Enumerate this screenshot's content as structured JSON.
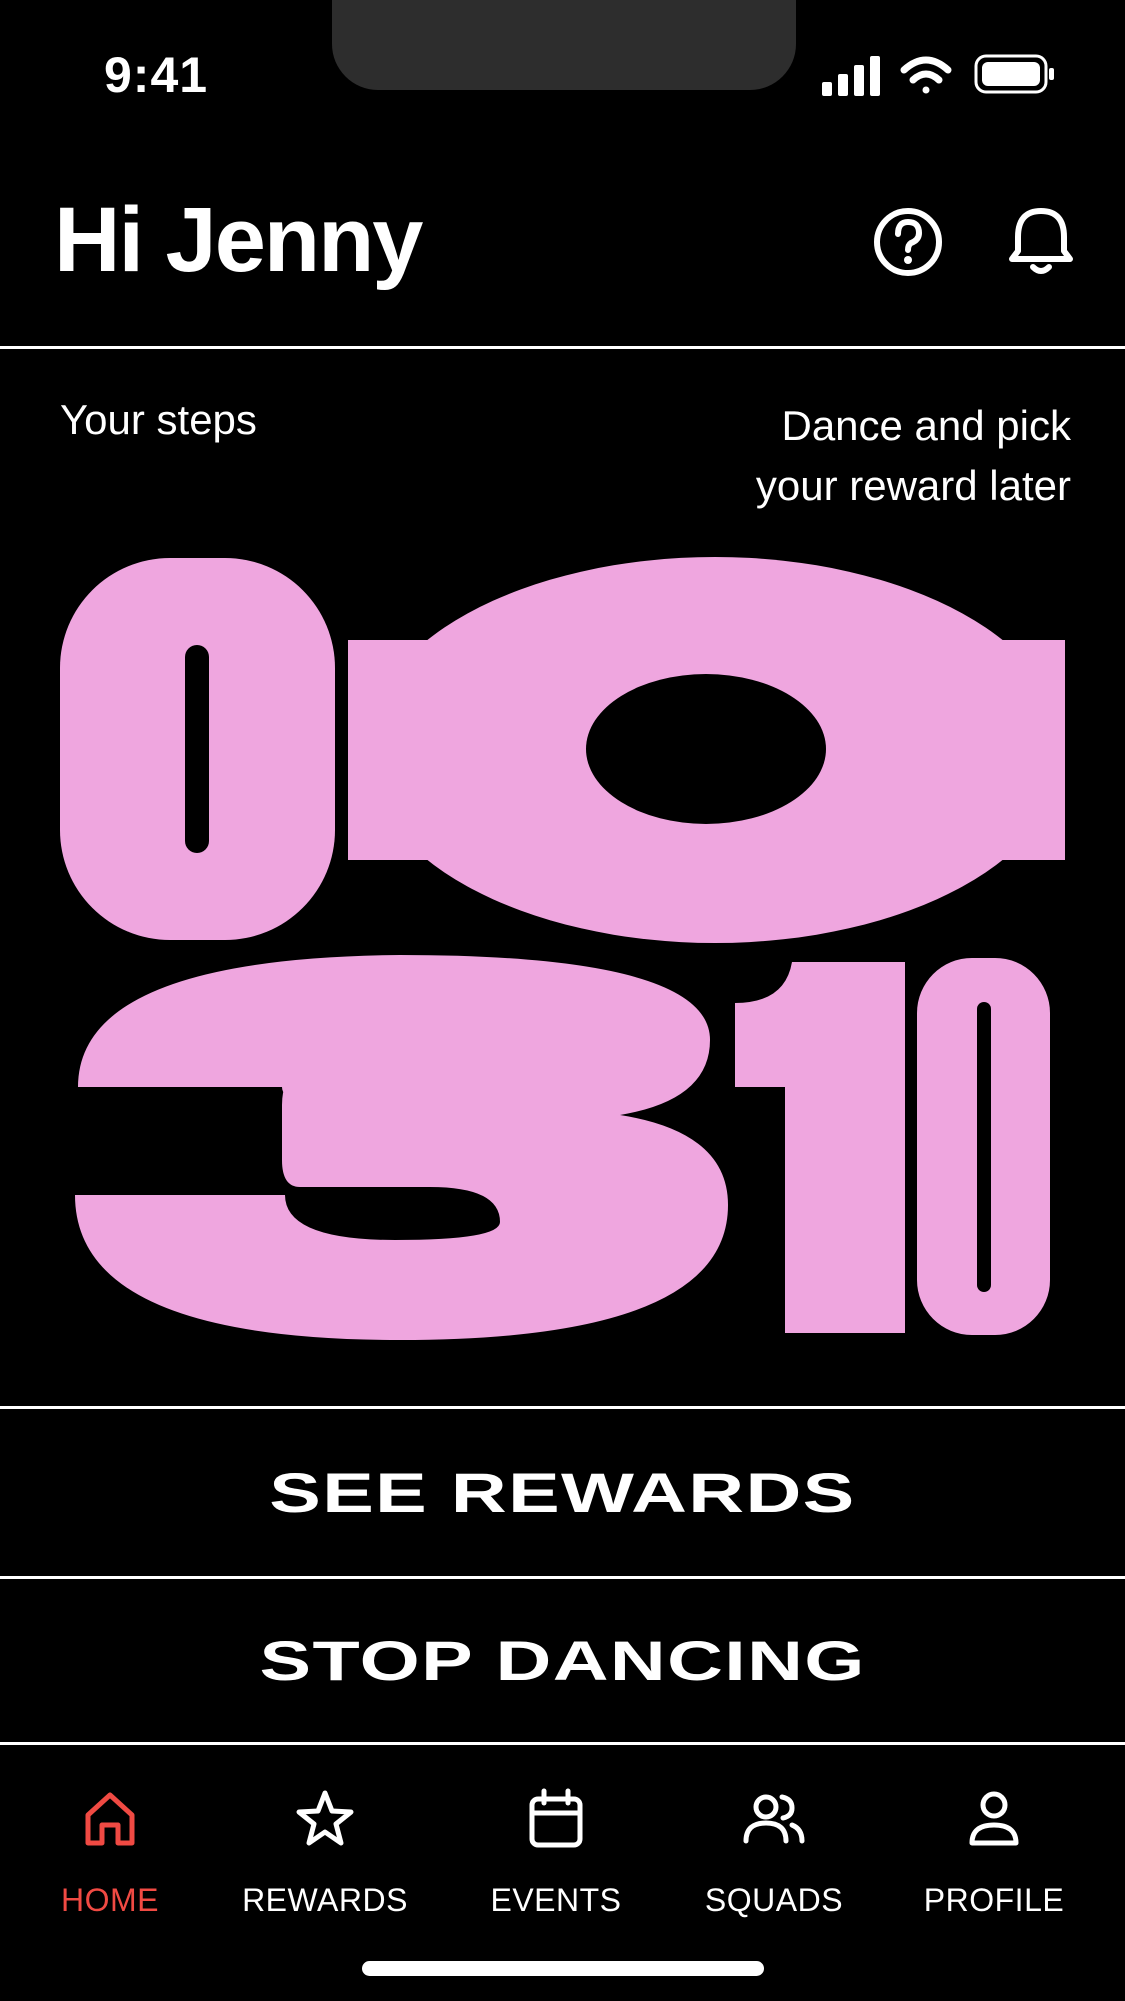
{
  "status_bar": {
    "time": "9:41"
  },
  "header": {
    "greeting": "Hi Jenny"
  },
  "steps": {
    "label": "Your steps",
    "hint_line1": "Dance and pick",
    "hint_line2": "your reward later",
    "value": "00310",
    "digit_color": "#efa6df"
  },
  "actions": {
    "see_rewards": "SEE REWARDS",
    "stop_dancing": "STOP DANCING"
  },
  "tabs": [
    {
      "label": "HOME",
      "icon": "home-icon",
      "active": true
    },
    {
      "label": "REWARDS",
      "icon": "star-icon",
      "active": false
    },
    {
      "label": "EVENTS",
      "icon": "calendar-icon",
      "active": false
    },
    {
      "label": "SQUADS",
      "icon": "users-icon",
      "active": false
    },
    {
      "label": "PROFILE",
      "icon": "user-icon",
      "active": false
    }
  ],
  "colors": {
    "background": "#000000",
    "foreground": "#ffffff",
    "accent_active": "#f04a43",
    "digits": "#efa6df"
  }
}
